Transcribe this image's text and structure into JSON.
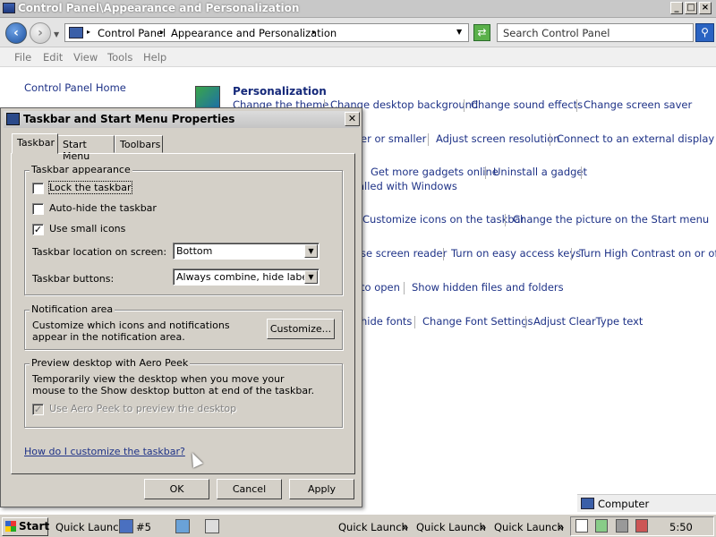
{
  "window": {
    "title": "Control Panel\\Appearance and Personalization"
  },
  "address": {
    "crumbs": [
      "Control Panel",
      "Appearance and Personalization"
    ],
    "search_placeholder": "Search Control Panel"
  },
  "menu": [
    "File",
    "Edit",
    "View",
    "Tools",
    "Help"
  ],
  "cp": {
    "home": "Control Panel Home",
    "personalization_title": "Personalization",
    "row1": [
      "Change the theme",
      "Change desktop background",
      "Change sound effects",
      "Change screen saver"
    ],
    "row2": [
      "er or smaller",
      "Adjust screen resolution",
      "Connect to an external display"
    ],
    "row3": [
      "Get more gadgets online",
      "Uninstall a gadget"
    ],
    "row3b": "alled with Windows",
    "row4": [
      "Customize icons on the taskbar",
      "Change the picture on the Start menu"
    ],
    "row5": [
      "se screen reader",
      "Turn on easy access keys",
      "Turn High Contrast on or off"
    ],
    "row6": [
      "to open",
      "Show hidden files and folders"
    ],
    "row7": [
      "hide fonts",
      "Change Font Settings",
      "Adjust ClearType text"
    ]
  },
  "dialog": {
    "title": "Taskbar and Start Menu Properties",
    "tabs": [
      "Taskbar",
      "Start Menu",
      "Toolbars"
    ],
    "appearance": {
      "title": "Taskbar appearance",
      "lock": {
        "label": "Lock the taskbar",
        "checked": false
      },
      "autohide": {
        "label": "Auto-hide the taskbar",
        "checked": false
      },
      "small_icons": {
        "label": "Use small icons",
        "checked": true
      },
      "location_label": "Taskbar location on screen:",
      "location_value": "Bottom",
      "buttons_label": "Taskbar buttons:",
      "buttons_value": "Always combine, hide labels"
    },
    "notification": {
      "title": "Notification area",
      "text": "Customize which icons and notifications appear in the notification area.",
      "customize": "Customize..."
    },
    "peek": {
      "title": "Preview desktop with Aero Peek",
      "text": "Temporarily view the desktop when you move your mouse to the Show desktop button at end of the taskbar.",
      "checkbox": {
        "label": "Use Aero Peek to preview the desktop",
        "checked": true,
        "disabled": true
      }
    },
    "help": "How do I customize the taskbar?",
    "ok": "OK",
    "cancel": "Cancel",
    "apply": "Apply"
  },
  "taskbar": {
    "start": "Start",
    "quick_launch_1": "Quick Launch",
    "item_label": "#5",
    "quick_launch_2": "Quick Launch",
    "quick_launch_3": "Quick Launch",
    "quick_launch_4": "Quick Launch",
    "clock": "5:50",
    "computer": "Computer"
  },
  "icons": [
    "back-icon",
    "forward-icon",
    "refresh-icon",
    "search-icon",
    "close-icon",
    "minimize-icon",
    "maximize-icon"
  ]
}
